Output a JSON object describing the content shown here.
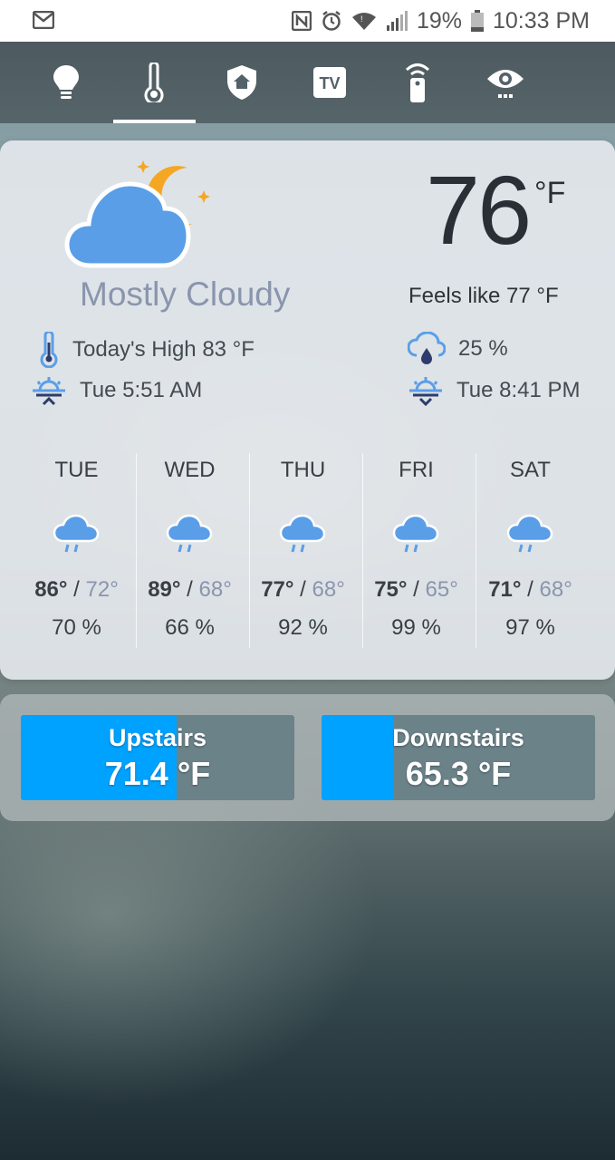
{
  "status_bar": {
    "battery": "19%",
    "time": "10:33 PM",
    "icons": [
      "gmail-icon",
      "nfc-icon",
      "alarm-icon",
      "wifi-icon",
      "signal-icon",
      "battery-icon"
    ]
  },
  "nav_tabs": [
    {
      "icon": "lightbulb-icon"
    },
    {
      "icon": "thermometer-icon",
      "selected": true
    },
    {
      "icon": "security-shield-icon"
    },
    {
      "icon": "tv-icon"
    },
    {
      "icon": "remote-icon"
    },
    {
      "icon": "eye-icon"
    }
  ],
  "weather": {
    "condition": "Mostly Cloudy",
    "condition_icon": "cloudy-night-icon",
    "temperature": "76",
    "unit": "°F",
    "feels_like": "Feels like 77 °F",
    "todays_high": "Today's High 83 °F",
    "sunrise": "Tue 5:51 AM",
    "precip": "25 %",
    "sunset": "Tue 8:41 PM"
  },
  "forecast": [
    {
      "day": "TUE",
      "high": "86°",
      "low": "72°",
      "precip": "70 %"
    },
    {
      "day": "WED",
      "high": "89°",
      "low": "68°",
      "precip": "66 %"
    },
    {
      "day": "THU",
      "high": "77°",
      "low": "68°",
      "precip": "92 %"
    },
    {
      "day": "FRI",
      "high": "75°",
      "low": "65°",
      "precip": "99 %"
    },
    {
      "day": "SAT",
      "high": "71°",
      "low": "68°",
      "precip": "97 %"
    }
  ],
  "separator": "/",
  "indoor": [
    {
      "name": "Upstairs",
      "value": "71.4 °F",
      "level": 0.57
    },
    {
      "name": "Downstairs",
      "value": "65.3 °F",
      "level": 0.26
    }
  ],
  "colors": {
    "accent": "#00a2ff",
    "cloud": "#5a9ee8",
    "moon": "#f5a623",
    "muted_text": "#8a95ad"
  }
}
